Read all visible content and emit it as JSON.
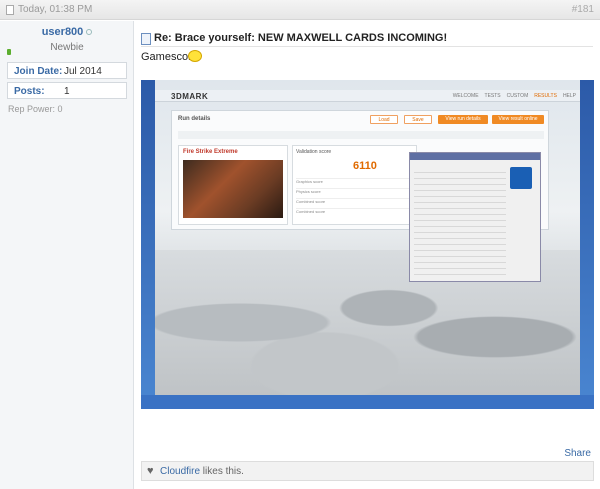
{
  "post": {
    "date": "Today, 01:38 PM",
    "number": "#181",
    "title": "Re: Brace yourself: NEW MAXWELL CARDS INCOMING!",
    "message": "Gamescom"
  },
  "user": {
    "name": "user800",
    "title": "Newbie",
    "join_label": "Join Date:",
    "join_value": "Jul 2014",
    "posts_label": "Posts:",
    "posts_value": "1",
    "rep_power": "Rep Power:",
    "rep_power_value": "0"
  },
  "screenshot": {
    "app_logo": "3DMARK",
    "nav": [
      "WELCOME",
      "TESTS",
      "CUSTOM",
      "RESULTS",
      "HELP"
    ],
    "run_details": "Run details",
    "load": "Load",
    "save": "Save",
    "view_details": "View run details",
    "view_online": "View result online",
    "test_name": "Fire Strike Extreme",
    "score_label": "Validation score",
    "score": "6110",
    "score_rows": [
      "Graphics score",
      "Physics score",
      "Combined score",
      "Combined score"
    ]
  },
  "footer": {
    "share": "Share",
    "like_user": "Cloudfire",
    "like_text": " likes this."
  },
  "icons": {
    "date": "document-icon",
    "title": "document-icon",
    "smiley": "smiley-icon",
    "like": "heart-icon"
  }
}
